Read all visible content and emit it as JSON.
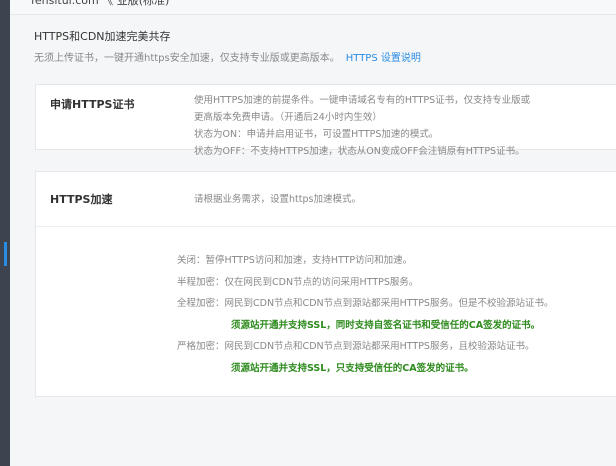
{
  "header": {
    "crumb": "fensitui.com  《 业版(标准)"
  },
  "section": {
    "title": "HTTPS和CDN加速完美共存",
    "subtitle": "无须上传证书，一键开通https安全加速，仅支持专业版或更高版本。",
    "help_link": "HTTPS 设置说明"
  },
  "cert_card": {
    "label": "申请HTTPS证书",
    "lines": [
      "使用HTTPS加速的前提条件。一键申请域名专有的HTTPS证书，仅支持专业版或",
      "更高版本免费申请。（开通后24小时内生效）",
      "状态为ON：申请并启用证书，可设置HTTPS加速的模式。",
      "状态为OFF：不支持HTTPS加速，状态从ON变成OFF会注销原有HTTPS证书。"
    ]
  },
  "accel_card": {
    "label": "HTTPS加速",
    "desc": "请根据业务需求，设置https加速模式。",
    "modes": [
      "关闭：暂停HTTPS访问和加速，支持HTTP访问和加速。",
      "半程加密：仅在网民到CDN节点的访问采用HTTPS服务。",
      "全程加密：网民到CDN节点和CDN节点到源站都采用HTTPS服务。但是不校验源站证书。",
      "须源站开通并支持SSL，同时支持自签名证书和受信任的CA签发的证书。",
      "严格加密：网民到CDN节点和CDN节点到源站都采用HTTPS服务，且校验源站证书。",
      "须源站开通并支持SSL，只支持受信任的CA签发的证书。"
    ]
  }
}
